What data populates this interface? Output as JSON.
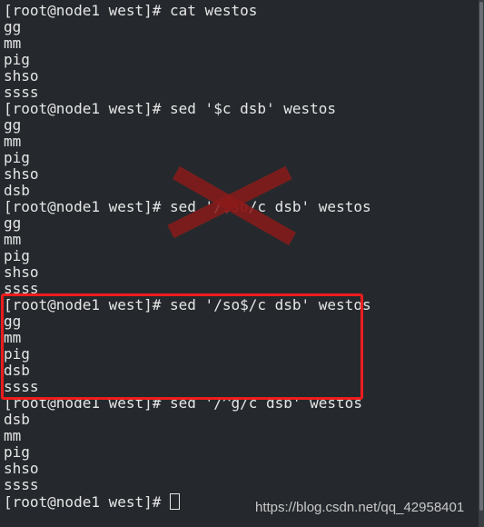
{
  "terminal": {
    "lines": [
      "[root@node1 west]# cat westos",
      "gg",
      "mm",
      "pig",
      "shso",
      "ssss",
      "[root@node1 west]# sed '$c dsb' westos",
      "gg",
      "mm",
      "pig",
      "shso",
      "dsb",
      "[root@node1 west]# sed '/$so/c dsb' westos",
      "gg",
      "mm",
      "pig",
      "shso",
      "ssss",
      "[root@node1 west]# sed '/so$/c dsb' westos",
      "gg",
      "mm",
      "pig",
      "dsb",
      "ssss",
      "[root@node1 west]# sed '/^g/c dsb' westos",
      "dsb",
      "mm",
      "pig",
      "shso",
      "ssss"
    ],
    "wrong_cmd": {
      "prefix": "[root@node1 west]# sed '/",
      "highlight": "$so",
      "suffix": "/c dsb' westos"
    },
    "prompt": "[root@node1 west]# "
  },
  "annotations": {
    "wrong_mark": "red-x-icon",
    "highlight_color": "#ee1c1c"
  },
  "watermark": "https://blog.csdn.net/qq_42958401"
}
